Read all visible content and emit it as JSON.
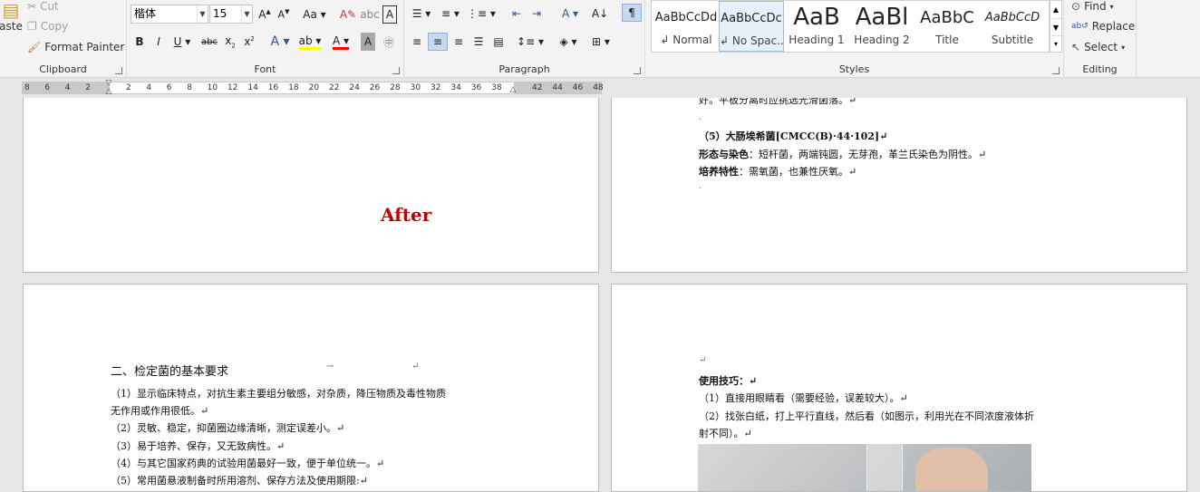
{
  "clipboard": {
    "paste_label": "aste",
    "cut_label": "Cut",
    "copy_label": "Copy",
    "format_painter_label": "Format Painter",
    "group_label": "Clipboard"
  },
  "font": {
    "name_value": "楷体",
    "size_value": "15",
    "group_label": "Font"
  },
  "paragraph": {
    "group_label": "Paragraph"
  },
  "styles": {
    "group_label": "Styles",
    "items": [
      {
        "preview": "AaBbCcDd",
        "name": "↲ Normal"
      },
      {
        "preview": "AaBbCcDc",
        "name": "↲ No Spac..."
      },
      {
        "preview": "AaB",
        "name": "Heading 1"
      },
      {
        "preview": "AaBl",
        "name": "Heading 2"
      },
      {
        "preview": "AaBbC",
        "name": "Title"
      },
      {
        "preview": "AaBbCcD",
        "name": "Subtitle"
      }
    ]
  },
  "editing": {
    "find_label": "Find",
    "replace_label": "Replace",
    "select_label": "Select",
    "group_label": "Editing"
  },
  "ruler": {
    "ticks": [
      "8",
      "6",
      "4",
      "2",
      "",
      "2",
      "4",
      "6",
      "8",
      "10",
      "12",
      "14",
      "16",
      "18",
      "20",
      "22",
      "24",
      "26",
      "28",
      "30",
      "32",
      "34",
      "36",
      "38",
      "",
      "42",
      "44",
      "46",
      "48"
    ]
  },
  "pages": {
    "p1": {
      "after_text": "After"
    },
    "p2": {
      "line0": "好。平板分离时应挑选光滑菌落。↵",
      "line1": "（5）大肠埃希菌[CMCC(B)·44·102]↵",
      "line2_b": "形态与染色",
      "line2": "：短杆菌，两端钝圆，无芽孢，革兰氏染色为阴性。↵",
      "line3_b": "培养特性",
      "line3": "：需氧菌，也兼性厌氧。↵"
    },
    "p3": {
      "heading": "二、检定菌的基本要求",
      "tab_mark": "→",
      "para_mark": "↵",
      "l1": "（1）显示临床特点，对抗生素主要组分敏感，对杂质，降压物质及毒性物质",
      "l1b": "无作用或作用很低。↵",
      "l2": "（2）灵敏、稳定，抑菌圈边缘清晰，测定误差小。↵",
      "l3": "（3）易于培养、保存，又无致病性。↵",
      "l4": "（4）与其它国家药典的试验用菌最好一致，便于单位统一。↵",
      "l5": "（5）常用菌悬液制备时所用溶剂、保存方法及使用期限:↵"
    },
    "p4": {
      "mark": "↵",
      "title": "使用技巧：↵",
      "l1": "（1）直接用眼睛看（需要经验，误差较大）。↵",
      "l2": "（2）找张白纸，打上平行直线，然后看（如图示，利用光在不同浓度液体折",
      "l2b": "射不同）。↵"
    }
  },
  "colors": {
    "after_text": "#c00000",
    "accent": "#2b579a"
  }
}
